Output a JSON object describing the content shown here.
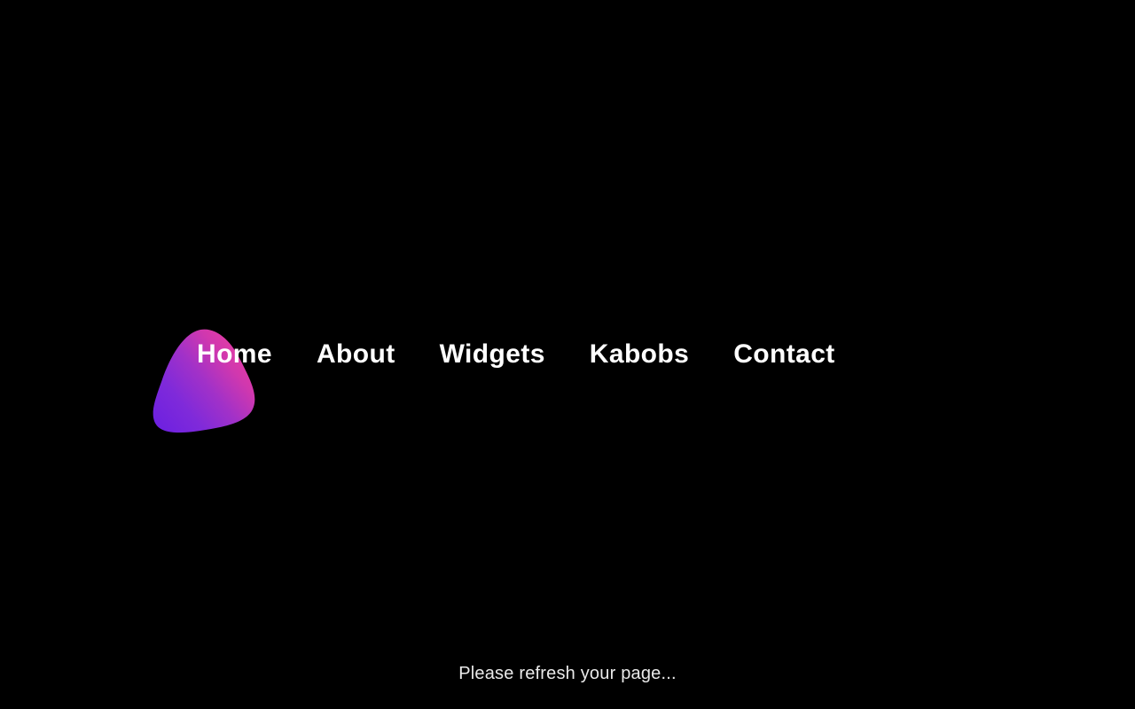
{
  "theme": {
    "background_color": "#000000",
    "nav_text_color": "#ffffff",
    "message_text_color": "#e9e9e9",
    "blob_gradient_start": "#7A28DC",
    "blob_gradient_mid": "#9A35D0",
    "blob_gradient_end": "#E23BA6"
  },
  "decoration": {
    "blob_icon_name": "gradient-blob-shape"
  },
  "nav": {
    "items": [
      {
        "label": "Home"
      },
      {
        "label": "About"
      },
      {
        "label": "Widgets"
      },
      {
        "label": "Kabobs"
      },
      {
        "label": "Contact"
      }
    ]
  },
  "status": {
    "message": "Please refresh your page..."
  }
}
